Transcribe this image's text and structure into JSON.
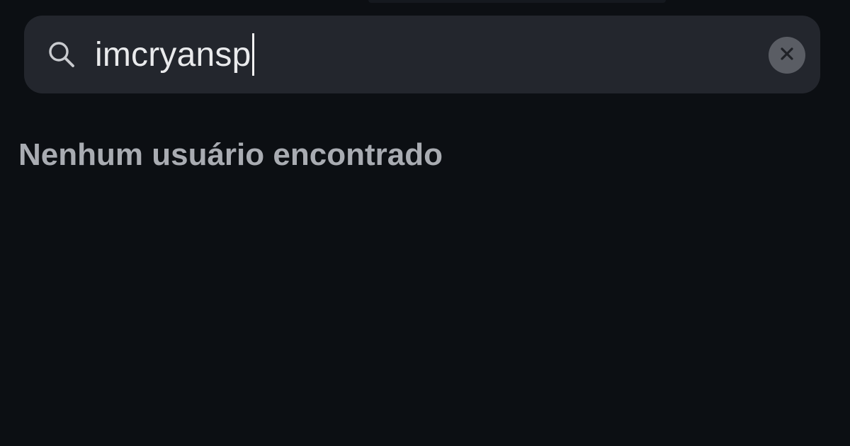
{
  "search": {
    "query": "imcryansp",
    "icon": "search-icon",
    "clear_icon": "close-icon"
  },
  "results": {
    "empty_message": "Nenhum usuário encontrado"
  },
  "colors": {
    "background": "#0c0f13",
    "search_bar": "#23262d",
    "query_text": "#e9eaec",
    "muted_text": "#a9acb2",
    "clear_button": "#5a5d64"
  }
}
